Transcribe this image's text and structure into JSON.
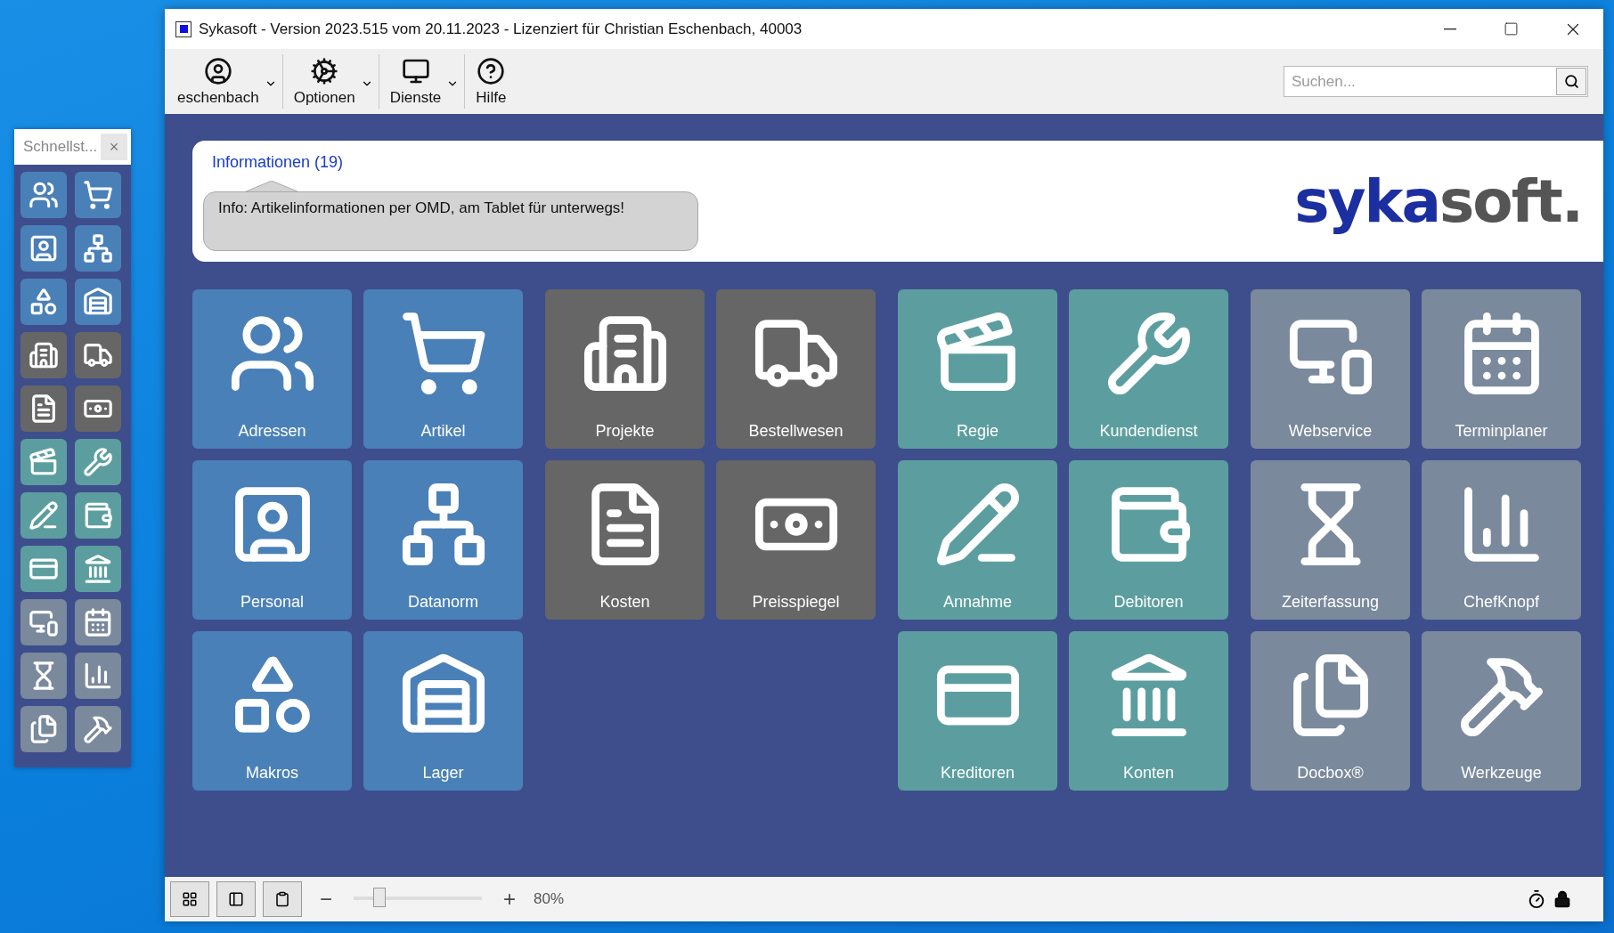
{
  "window": {
    "title": "Sykasoft - Version 2023.515 vom 20.11.2023 - Lizenziert für Christian Eschenbach, 40003"
  },
  "toolbar": {
    "buttons": [
      {
        "label": "eschenbach",
        "dropdown": true
      },
      {
        "label": "Optionen",
        "dropdown": true
      },
      {
        "label": "Dienste",
        "dropdown": true
      },
      {
        "label": "Hilfe",
        "dropdown": false
      }
    ]
  },
  "search": {
    "placeholder": "Suchen..."
  },
  "info": {
    "link": "Informationen (19)",
    "message": "Info: Artikelinformationen per OMD, am Tablet für unterwegs!"
  },
  "logo": {
    "primary": "syka",
    "secondary": "soft."
  },
  "tile_groups": [
    {
      "color": "#4a80b8",
      "tiles": [
        {
          "label": "Adressen"
        },
        {
          "label": "Artikel"
        },
        {
          "label": "Personal"
        },
        {
          "label": "Datanorm"
        },
        {
          "label": "Makros"
        },
        {
          "label": "Lager"
        }
      ]
    },
    {
      "color": "#666666",
      "tiles": [
        {
          "label": "Projekte"
        },
        {
          "label": "Bestellwesen"
        },
        {
          "label": "Kosten"
        },
        {
          "label": "Preisspiegel"
        }
      ]
    },
    {
      "color": "#5c9e9f",
      "tiles": [
        {
          "label": "Regie"
        },
        {
          "label": "Kundendienst"
        },
        {
          "label": "Annahme"
        },
        {
          "label": "Debitoren"
        },
        {
          "label": "Kreditoren"
        },
        {
          "label": "Konten"
        }
      ]
    },
    {
      "color": "#7a899c",
      "tiles": [
        {
          "label": "Webservice"
        },
        {
          "label": "Terminplaner"
        },
        {
          "label": "Zeiterfassung"
        },
        {
          "label": "ChefKnopf"
        },
        {
          "label": "Docbox®"
        },
        {
          "label": "Werkzeuge"
        }
      ]
    }
  ],
  "quick_launch": {
    "title": "Schnellst...",
    "close": "×"
  },
  "status_bar": {
    "minus": "−",
    "plus": "+",
    "zoom": {
      "level": 0.2,
      "reading": "80%"
    }
  }
}
